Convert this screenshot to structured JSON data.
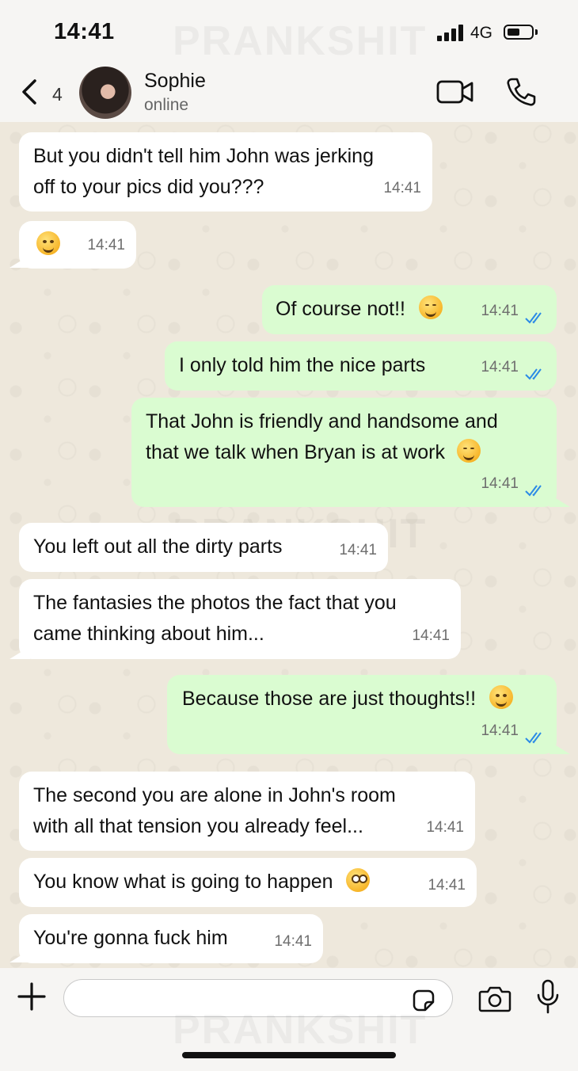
{
  "status": {
    "time": "14:41",
    "network": "4G"
  },
  "watermark": "PRANKSHIT",
  "header": {
    "back_count": "4",
    "contact_name": "Sophie",
    "presence": "online"
  },
  "messages": [
    {
      "dir": "in",
      "lines": [
        "But you didn't tell him John was jerking",
        "off to your pics did you???"
      ],
      "time": "14:41"
    },
    {
      "dir": "in",
      "lines": [
        ""
      ],
      "emoji": "grinning-sweat-emoji",
      "time": "14:41"
    },
    {
      "dir": "out",
      "lines": [
        "Of course not!!"
      ],
      "emoji": "relieved-emoji",
      "time": "14:41",
      "read": true
    },
    {
      "dir": "out",
      "lines": [
        "I only told him the nice parts"
      ],
      "time": "14:41",
      "read": true
    },
    {
      "dir": "out",
      "lines": [
        "That John is friendly and handsome and",
        "that we talk when Bryan is at work"
      ],
      "emoji": "smiling-hearts-emoji",
      "time": "14:41",
      "read": true
    },
    {
      "dir": "in",
      "lines": [
        "You left out all the dirty parts"
      ],
      "time": "14:41"
    },
    {
      "dir": "in",
      "lines": [
        "The fantasies the photos the fact that you",
        "came thinking about him..."
      ],
      "time": "14:41"
    },
    {
      "dir": "out",
      "lines": [
        "Because those are just thoughts!!"
      ],
      "emoji": "hand-over-mouth-emoji",
      "time": "14:41",
      "read": true
    },
    {
      "dir": "in",
      "lines": [
        "The second you are alone in John's room",
        "with all that tension you already feel..."
      ],
      "time": "14:41"
    },
    {
      "dir": "in",
      "lines": [
        "You know what is going to happen"
      ],
      "emoji": "flushed-emoji",
      "time": "14:41"
    },
    {
      "dir": "in",
      "lines": [
        "You're gonna fuck him"
      ],
      "time": "14:41"
    }
  ],
  "composer": {
    "placeholder": ""
  },
  "colors": {
    "incoming": "#ffffff",
    "outgoing": "#dafcd1",
    "read_tick": "#2b8ae6",
    "wallpaper": "#eee8dc"
  }
}
